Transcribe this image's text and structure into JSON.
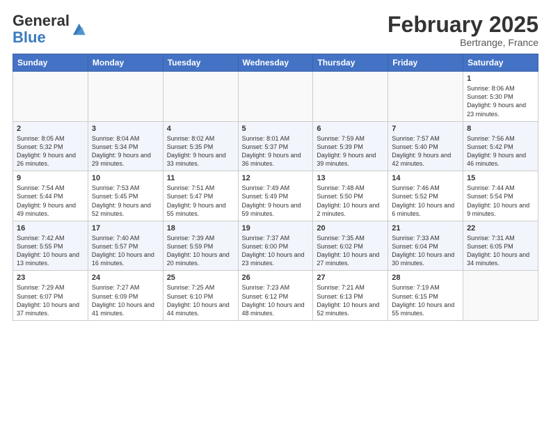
{
  "header": {
    "logo_general": "General",
    "logo_blue": "Blue",
    "month": "February 2025",
    "location": "Bertrange, France"
  },
  "weekdays": [
    "Sunday",
    "Monday",
    "Tuesday",
    "Wednesday",
    "Thursday",
    "Friday",
    "Saturday"
  ],
  "weeks": [
    [
      {
        "day": "",
        "info": ""
      },
      {
        "day": "",
        "info": ""
      },
      {
        "day": "",
        "info": ""
      },
      {
        "day": "",
        "info": ""
      },
      {
        "day": "",
        "info": ""
      },
      {
        "day": "",
        "info": ""
      },
      {
        "day": "1",
        "info": "Sunrise: 8:06 AM\nSunset: 5:30 PM\nDaylight: 9 hours and 23 minutes."
      }
    ],
    [
      {
        "day": "2",
        "info": "Sunrise: 8:05 AM\nSunset: 5:32 PM\nDaylight: 9 hours and 26 minutes."
      },
      {
        "day": "3",
        "info": "Sunrise: 8:04 AM\nSunset: 5:34 PM\nDaylight: 9 hours and 29 minutes."
      },
      {
        "day": "4",
        "info": "Sunrise: 8:02 AM\nSunset: 5:35 PM\nDaylight: 9 hours and 33 minutes."
      },
      {
        "day": "5",
        "info": "Sunrise: 8:01 AM\nSunset: 5:37 PM\nDaylight: 9 hours and 36 minutes."
      },
      {
        "day": "6",
        "info": "Sunrise: 7:59 AM\nSunset: 5:39 PM\nDaylight: 9 hours and 39 minutes."
      },
      {
        "day": "7",
        "info": "Sunrise: 7:57 AM\nSunset: 5:40 PM\nDaylight: 9 hours and 42 minutes."
      },
      {
        "day": "8",
        "info": "Sunrise: 7:56 AM\nSunset: 5:42 PM\nDaylight: 9 hours and 46 minutes."
      }
    ],
    [
      {
        "day": "9",
        "info": "Sunrise: 7:54 AM\nSunset: 5:44 PM\nDaylight: 9 hours and 49 minutes."
      },
      {
        "day": "10",
        "info": "Sunrise: 7:53 AM\nSunset: 5:45 PM\nDaylight: 9 hours and 52 minutes."
      },
      {
        "day": "11",
        "info": "Sunrise: 7:51 AM\nSunset: 5:47 PM\nDaylight: 9 hours and 55 minutes."
      },
      {
        "day": "12",
        "info": "Sunrise: 7:49 AM\nSunset: 5:49 PM\nDaylight: 9 hours and 59 minutes."
      },
      {
        "day": "13",
        "info": "Sunrise: 7:48 AM\nSunset: 5:50 PM\nDaylight: 10 hours and 2 minutes."
      },
      {
        "day": "14",
        "info": "Sunrise: 7:46 AM\nSunset: 5:52 PM\nDaylight: 10 hours and 6 minutes."
      },
      {
        "day": "15",
        "info": "Sunrise: 7:44 AM\nSunset: 5:54 PM\nDaylight: 10 hours and 9 minutes."
      }
    ],
    [
      {
        "day": "16",
        "info": "Sunrise: 7:42 AM\nSunset: 5:55 PM\nDaylight: 10 hours and 13 minutes."
      },
      {
        "day": "17",
        "info": "Sunrise: 7:40 AM\nSunset: 5:57 PM\nDaylight: 10 hours and 16 minutes."
      },
      {
        "day": "18",
        "info": "Sunrise: 7:39 AM\nSunset: 5:59 PM\nDaylight: 10 hours and 20 minutes."
      },
      {
        "day": "19",
        "info": "Sunrise: 7:37 AM\nSunset: 6:00 PM\nDaylight: 10 hours and 23 minutes."
      },
      {
        "day": "20",
        "info": "Sunrise: 7:35 AM\nSunset: 6:02 PM\nDaylight: 10 hours and 27 minutes."
      },
      {
        "day": "21",
        "info": "Sunrise: 7:33 AM\nSunset: 6:04 PM\nDaylight: 10 hours and 30 minutes."
      },
      {
        "day": "22",
        "info": "Sunrise: 7:31 AM\nSunset: 6:05 PM\nDaylight: 10 hours and 34 minutes."
      }
    ],
    [
      {
        "day": "23",
        "info": "Sunrise: 7:29 AM\nSunset: 6:07 PM\nDaylight: 10 hours and 37 minutes."
      },
      {
        "day": "24",
        "info": "Sunrise: 7:27 AM\nSunset: 6:09 PM\nDaylight: 10 hours and 41 minutes."
      },
      {
        "day": "25",
        "info": "Sunrise: 7:25 AM\nSunset: 6:10 PM\nDaylight: 10 hours and 44 minutes."
      },
      {
        "day": "26",
        "info": "Sunrise: 7:23 AM\nSunset: 6:12 PM\nDaylight: 10 hours and 48 minutes."
      },
      {
        "day": "27",
        "info": "Sunrise: 7:21 AM\nSunset: 6:13 PM\nDaylight: 10 hours and 52 minutes."
      },
      {
        "day": "28",
        "info": "Sunrise: 7:19 AM\nSunset: 6:15 PM\nDaylight: 10 hours and 55 minutes."
      },
      {
        "day": "",
        "info": ""
      }
    ]
  ]
}
